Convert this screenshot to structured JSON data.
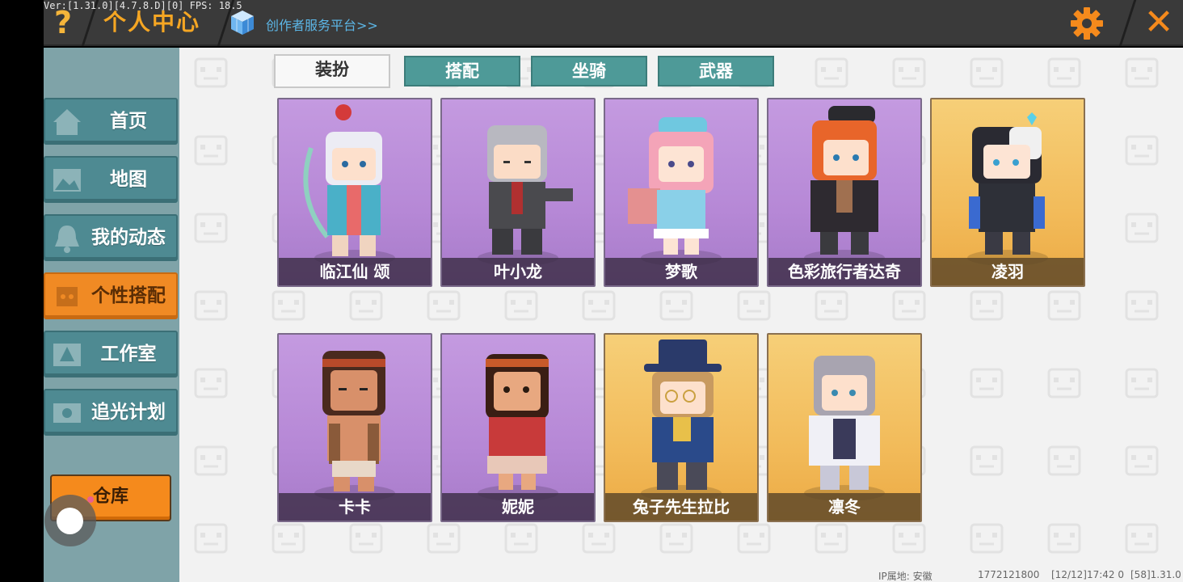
{
  "debug": "Ver:[1.31.0][4.7.8.D][0] FPS: 18.5",
  "header": {
    "title": "个人中心",
    "creator_link": "创作者服务平台>>"
  },
  "sidebar": {
    "items": [
      {
        "label": "首页",
        "icon": "house-icon"
      },
      {
        "label": "地图",
        "icon": "picture-icon"
      },
      {
        "label": "我的动态",
        "icon": "bell-icon"
      },
      {
        "label": "个性搭配",
        "icon": "character-icon",
        "active": true
      },
      {
        "label": "工作室",
        "icon": "tree-icon"
      },
      {
        "label": "追光计划",
        "icon": "ticket-icon"
      }
    ],
    "warehouse_label": "仓库"
  },
  "tabs": [
    {
      "label": "装扮",
      "active": true
    },
    {
      "label": "搭配"
    },
    {
      "label": "坐骑"
    },
    {
      "label": "武器"
    }
  ],
  "skins": [
    {
      "name": "临江仙 颂",
      "rarity": "purple"
    },
    {
      "name": "叶小龙",
      "rarity": "purple"
    },
    {
      "name": "梦歌",
      "rarity": "purple"
    },
    {
      "name": "色彩旅行者达奇",
      "rarity": "purple"
    },
    {
      "name": "凌羽",
      "rarity": "gold"
    },
    {
      "name": "卡卡",
      "rarity": "purple"
    },
    {
      "name": "妮妮",
      "rarity": "purple"
    },
    {
      "name": "兔子先生拉比",
      "rarity": "gold"
    },
    {
      "name": "凛冬",
      "rarity": "gold"
    }
  ],
  "footer": {
    "ip_location": "IP属地: 安徽",
    "uid": "1772121800",
    "timestamp": "[12/12]17:42 0",
    "version": "[58]1.31.0"
  },
  "colors": {
    "accent_orange": "#f08a24",
    "nav_teal": "#4e8a92",
    "tab_teal": "#4e9a98",
    "purple_card": "#b688d6",
    "gold_card": "#f2bb5a"
  }
}
